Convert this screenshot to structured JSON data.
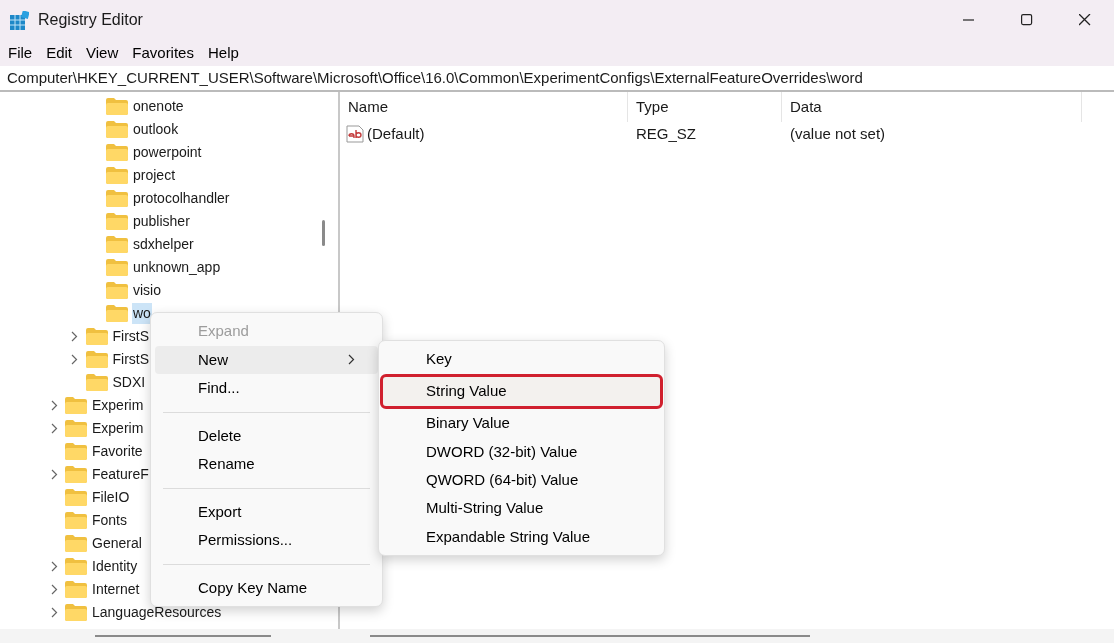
{
  "window": {
    "title": "Registry Editor"
  },
  "menu_bar": [
    "File",
    "Edit",
    "View",
    "Favorites",
    "Help"
  ],
  "address": "Computer\\HKEY_CURRENT_USER\\Software\\Microsoft\\Office\\16.0\\Common\\ExperimentConfigs\\ExternalFeatureOverrides\\word",
  "tree": [
    {
      "children": [
        {
          "children": [
            {
              "label": "onenote",
              "expandable": false,
              "selected": false
            },
            {
              "label": "outlook",
              "expandable": false,
              "selected": false
            },
            {
              "label": "powerpoint",
              "expandable": false,
              "selected": false
            },
            {
              "label": "project",
              "expandable": false,
              "selected": false
            },
            {
              "label": "protocolhandler",
              "expandable": false,
              "selected": false
            },
            {
              "label": "publisher",
              "expandable": false,
              "selected": false
            },
            {
              "label": "sdxhelper",
              "expandable": false,
              "selected": false
            },
            {
              "label": "unknown_app",
              "expandable": false,
              "selected": false
            },
            {
              "label": "visio",
              "expandable": false,
              "selected": false
            },
            {
              "label": "wo",
              "expandable": false,
              "selected": true
            }
          ]
        },
        {
          "label": "FirstS",
          "expandable": true,
          "selected": false
        },
        {
          "label": "FirstS",
          "expandable": true,
          "selected": false
        },
        {
          "label": "SDXI",
          "expandable": false,
          "selected": false
        }
      ]
    },
    {
      "label": "Experim",
      "expandable": true,
      "selected": false
    },
    {
      "label": "Experim",
      "expandable": true,
      "selected": false
    },
    {
      "label": "Favorite",
      "expandable": false,
      "selected": false
    },
    {
      "label": "FeatureF",
      "expandable": true,
      "selected": false
    },
    {
      "label": "FileIO",
      "expandable": false,
      "selected": false
    },
    {
      "label": "Fonts",
      "expandable": false,
      "selected": false
    },
    {
      "label": "General",
      "expandable": false,
      "selected": false
    },
    {
      "label": "Identity",
      "expandable": true,
      "selected": false
    },
    {
      "label": "Internet",
      "expandable": true,
      "selected": false
    },
    {
      "label": "LanguageResources",
      "expandable": true,
      "selected": false
    }
  ],
  "values_list": {
    "columns": [
      "Name",
      "Type",
      "Data"
    ],
    "rows": [
      {
        "cells": [
          "(Default)",
          "REG_SZ",
          "(value not set)"
        ]
      }
    ]
  },
  "context_menu": [
    {
      "kind": "item",
      "label": "Expand",
      "disabled": true,
      "hovered": false,
      "submenu": false
    },
    {
      "kind": "item",
      "label": "New",
      "disabled": false,
      "hovered": true,
      "submenu": true
    },
    {
      "kind": "item",
      "label": "Find...",
      "disabled": false,
      "hovered": false,
      "submenu": false
    },
    {
      "kind": "separator"
    },
    {
      "kind": "item",
      "label": "Delete",
      "disabled": false,
      "hovered": false,
      "submenu": false
    },
    {
      "kind": "item",
      "label": "Rename",
      "disabled": false,
      "hovered": false,
      "submenu": false
    },
    {
      "kind": "separator"
    },
    {
      "kind": "item",
      "label": "Export",
      "disabled": false,
      "hovered": false,
      "submenu": false
    },
    {
      "kind": "item",
      "label": "Permissions...",
      "disabled": false,
      "hovered": false,
      "submenu": false
    },
    {
      "kind": "separator"
    },
    {
      "kind": "item",
      "label": "Copy Key Name",
      "disabled": false,
      "hovered": false,
      "submenu": false
    }
  ],
  "submenu": [
    {
      "label": "Key",
      "highlighted": false
    },
    {
      "label": "String Value",
      "highlighted": true
    },
    {
      "label": "Binary Value",
      "highlighted": false
    },
    {
      "label": "DWORD (32-bit) Value",
      "highlighted": false
    },
    {
      "label": "QWORD (64-bit) Value",
      "highlighted": false
    },
    {
      "label": "Multi-String Value",
      "highlighted": false
    },
    {
      "label": "Expandable String Value",
      "highlighted": false
    }
  ]
}
